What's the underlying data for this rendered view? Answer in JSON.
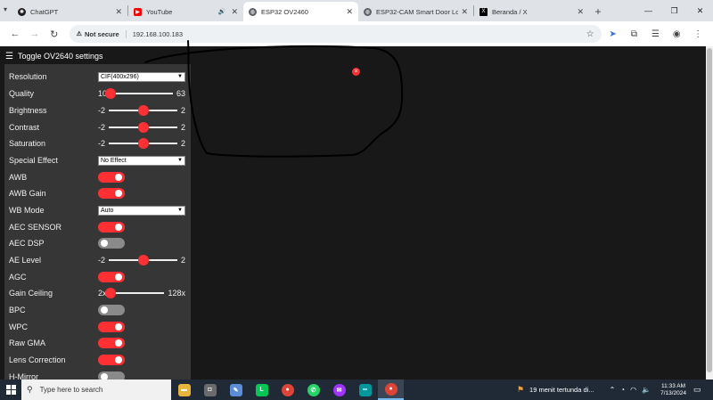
{
  "browser": {
    "tabs": [
      {
        "title": "ChatGPT",
        "color": "#1f1f1f",
        "glyph": "✺",
        "active": false
      },
      {
        "title": "YouTube",
        "color": "#ff0000",
        "glyph": "▶",
        "active": false
      },
      {
        "title": "ESP32 OV2460",
        "color": "#5f6368",
        "glyph": "◍",
        "active": true
      },
      {
        "title": "ESP32-CAM Smart Door Lo",
        "color": "#5f6368",
        "glyph": "◍",
        "active": false
      },
      {
        "title": "Beranda / X",
        "color": "#000000",
        "glyph": "X",
        "active": false
      }
    ],
    "security_label": "Not secure",
    "url": "192.168.100.183"
  },
  "menu": {
    "toggle_label": "Toggle OV2640 settings"
  },
  "settings": {
    "resolution": {
      "label": "Resolution",
      "value": "CIF(400x296)"
    },
    "quality": {
      "label": "Quality",
      "min": "10",
      "max": "63",
      "fraction": 0.0
    },
    "brightness": {
      "label": "Brightness",
      "min": "-2",
      "max": "2",
      "fraction": 0.5
    },
    "contrast": {
      "label": "Contrast",
      "min": "-2",
      "max": "2",
      "fraction": 0.5
    },
    "saturation": {
      "label": "Saturation",
      "min": "-2",
      "max": "2",
      "fraction": 0.5
    },
    "special_effect": {
      "label": "Special Effect",
      "value": "No Effect"
    },
    "awb": {
      "label": "AWB",
      "on": true
    },
    "awb_gain": {
      "label": "AWB Gain",
      "on": true
    },
    "wb_mode": {
      "label": "WB Mode",
      "value": "Auto"
    },
    "aec_sensor": {
      "label": "AEC SENSOR",
      "on": true
    },
    "aec_dsp": {
      "label": "AEC DSP",
      "on": false
    },
    "ae_level": {
      "label": "AE Level",
      "min": "-2",
      "max": "2",
      "fraction": 0.5
    },
    "agc": {
      "label": "AGC",
      "on": true
    },
    "gain_ceiling": {
      "label": "Gain Ceiling",
      "min": "2x",
      "max": "128x",
      "fraction": 0.0
    },
    "bpc": {
      "label": "BPC",
      "on": false
    },
    "wpc": {
      "label": "WPC",
      "on": true
    },
    "raw_gma": {
      "label": "Raw GMA",
      "on": true
    },
    "lens_correction": {
      "label": "Lens Correction",
      "on": true
    },
    "h_mirror": {
      "label": "H-Mirror",
      "on": false
    }
  },
  "stream": {
    "close_glyph": "×"
  },
  "taskbar": {
    "search_placeholder": "Type here to search",
    "weather_text": "19 menit tertunda di...",
    "time": "11:33 AM",
    "date": "7/13/2024",
    "apps": [
      {
        "name": "file-explorer",
        "color": "#e8b53b",
        "glyph": "▬"
      },
      {
        "name": "game",
        "color": "#6b6b6b",
        "glyph": "🎮"
      },
      {
        "name": "paint",
        "color": "#5b8dd6",
        "glyph": "✎"
      },
      {
        "name": "line",
        "color": "#06c755",
        "glyph": "L"
      },
      {
        "name": "chrome",
        "color": "#db4437",
        "glyph": "●"
      },
      {
        "name": "whatsapp",
        "color": "#25d366",
        "glyph": "✆"
      },
      {
        "name": "messenger",
        "color": "#a033ff",
        "glyph": "✉"
      },
      {
        "name": "arduino",
        "color": "#00979d",
        "glyph": "∞"
      },
      {
        "name": "chrome-active",
        "color": "#db4437",
        "glyph": "●"
      }
    ]
  }
}
